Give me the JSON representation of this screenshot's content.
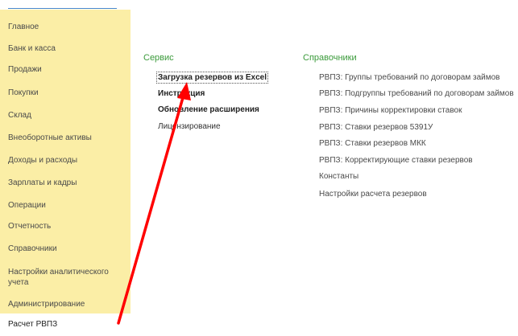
{
  "sidebar": {
    "items": [
      {
        "label": "Главное"
      },
      {
        "label": "Банк и касса"
      },
      {
        "label": "Продажи"
      },
      {
        "label": "Покупки"
      },
      {
        "label": "Склад"
      },
      {
        "label": "Внеоборотные активы"
      },
      {
        "label": "Доходы и расходы"
      },
      {
        "label": "Зарплаты и кадры"
      },
      {
        "label": "Операции"
      },
      {
        "label": "Отчетность"
      },
      {
        "label": "Справочники"
      },
      {
        "label": "Настройки аналитического учета"
      },
      {
        "label": "Администрирование"
      }
    ],
    "current": "Расчет РВПЗ"
  },
  "service": {
    "title": "Сервис",
    "items": [
      {
        "label": "Загрузка резервов из Excel"
      },
      {
        "label": "Инструкция"
      },
      {
        "label": "Обновление расширения"
      },
      {
        "label": "Лицензирование"
      }
    ]
  },
  "references": {
    "title": "Справочники",
    "items": [
      {
        "label": "РВПЗ: Группы требований по договорам займов"
      },
      {
        "label": "РВПЗ: Подгруппы требований по договорам займов"
      },
      {
        "label": "РВПЗ: Причины корректировки ставок"
      },
      {
        "label": "РВПЗ: Ставки резервов 5391У"
      },
      {
        "label": "РВПЗ: Ставки резервов МКК"
      },
      {
        "label": "РВПЗ: Корректирующие ставки резервов"
      },
      {
        "label": "Константы"
      },
      {
        "label": "Настройки расчета резервов"
      }
    ]
  },
  "colors": {
    "sidebar_bg": "#fbeea6",
    "section_title": "#3a9a3a",
    "annotation_arrow": "#ff0000"
  }
}
